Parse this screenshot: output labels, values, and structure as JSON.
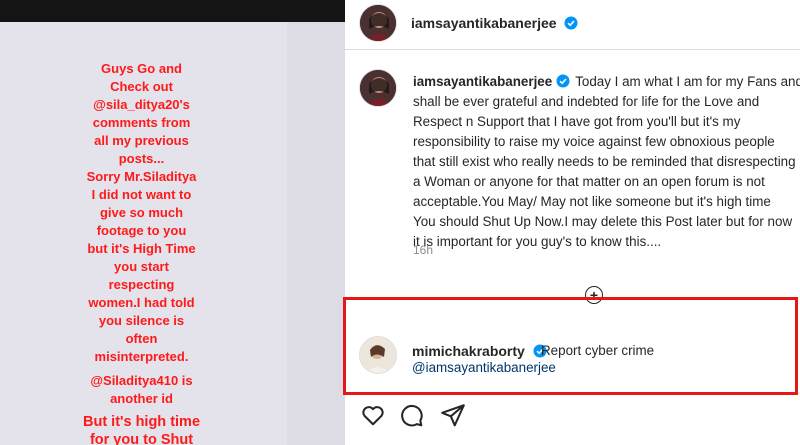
{
  "story": {
    "lines": [
      "Guys Go and",
      "Check out",
      "@sila_ditya20's",
      "comments from",
      "all my previous",
      "posts...",
      "Sorry Mr.Siladitya",
      "I did not want to",
      "give so much",
      "footage to you",
      "but it's High Time",
      "you start",
      "respecting",
      "women.I had told",
      "you silence is",
      "often",
      "misinterpreted.",
      "@Siladitya410 is",
      "another id",
      "But it's high time",
      "for you to Shut"
    ]
  },
  "post": {
    "header": {
      "username": "iamsayantikabanerjee",
      "verified_icon": "verified-badge-icon"
    },
    "caption": {
      "username": "iamsayantikabanerjee",
      "lines": [
        "Today I am what I am for my Fans and",
        "shall be ever grateful and indebted for life for the Love and",
        "Respect n Support that I have got from you'll but it's my",
        "responsibility to raise my voice against few obnoxious people",
        "that still exist who really needs to be reminded that disrespecting",
        "a Woman or anyone for that matter on an open forum is not",
        "acceptable.You May/ May not like someone but it's high time",
        "You should Shut Up Now.I may delete this Post later but for now",
        "it is important for you guy's to know this...."
      ],
      "time": "16h"
    },
    "load_more_icon": "plus-circle-icon",
    "comment": {
      "username": "mimichakraborty",
      "text": "Report cyber crime",
      "mention": "@iamsayantikabanerjee"
    },
    "actions": [
      "heart-icon",
      "comment-icon",
      "share-icon"
    ]
  },
  "colors": {
    "highlight": "#e61717",
    "story_text": "#ff1a1a",
    "verified": "#0095f6",
    "mention": "#00376b"
  }
}
